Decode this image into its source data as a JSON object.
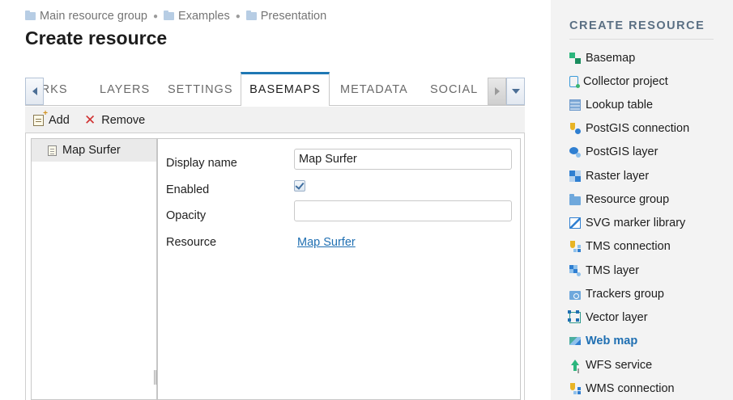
{
  "breadcrumb": [
    {
      "label": "Main resource group"
    },
    {
      "label": "Examples"
    },
    {
      "label": "Presentation"
    }
  ],
  "page_title": "Create resource",
  "tabs": [
    {
      "label": "ARKS"
    },
    {
      "label": "LAYERS"
    },
    {
      "label": "SETTINGS"
    },
    {
      "label": "BASEMAPS",
      "active": true
    },
    {
      "label": "METADATA"
    },
    {
      "label": "SOCIAL"
    }
  ],
  "toolbar": {
    "add_label": "Add",
    "remove_label": "Remove"
  },
  "tree": {
    "items": [
      {
        "label": "Map Surfer",
        "selected": true
      }
    ]
  },
  "form": {
    "display_name_label": "Display name",
    "display_name_value": "Map Surfer",
    "enabled_label": "Enabled",
    "enabled_checked": true,
    "opacity_label": "Opacity",
    "opacity_value": "",
    "resource_label": "Resource",
    "resource_link": "Map Surfer"
  },
  "right_panel": {
    "title": "CREATE RESOURCE",
    "items": [
      {
        "label": "Basemap",
        "icon": "basemap-icon"
      },
      {
        "label": "Collector project",
        "icon": "collector-project-icon"
      },
      {
        "label": "Lookup table",
        "icon": "lookup-table-icon"
      },
      {
        "label": "PostGIS connection",
        "icon": "postgis-connection-icon"
      },
      {
        "label": "PostGIS layer",
        "icon": "postgis-layer-icon"
      },
      {
        "label": "Raster layer",
        "icon": "raster-layer-icon"
      },
      {
        "label": "Resource group",
        "icon": "resource-group-icon"
      },
      {
        "label": "SVG marker library",
        "icon": "svg-marker-library-icon"
      },
      {
        "label": "TMS connection",
        "icon": "tms-connection-icon"
      },
      {
        "label": "TMS layer",
        "icon": "tms-layer-icon"
      },
      {
        "label": "Trackers group",
        "icon": "trackers-group-icon"
      },
      {
        "label": "Vector layer",
        "icon": "vector-layer-icon"
      },
      {
        "label": "Web map",
        "icon": "web-map-icon",
        "highlighted": true
      },
      {
        "label": "WFS service",
        "icon": "wfs-service-icon"
      },
      {
        "label": "WMS connection",
        "icon": "wms-connection-icon"
      }
    ]
  },
  "colors": {
    "accent": "#1f78b4",
    "link": "#1f6fb2",
    "sidebar_bg": "#f3f3f3"
  }
}
